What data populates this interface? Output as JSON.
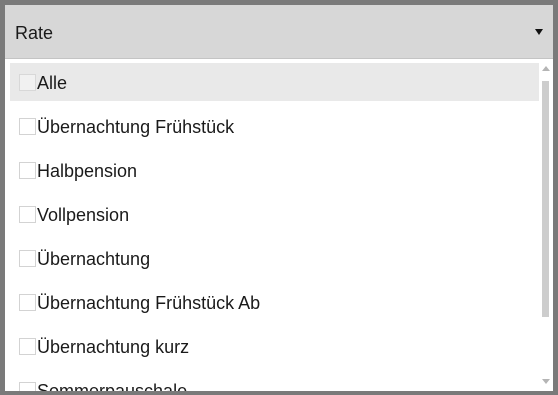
{
  "header": {
    "label": "Rate",
    "icon": "dropdown-arrow-icon"
  },
  "list": {
    "items": [
      {
        "label": "Alle",
        "checked": false,
        "highlighted": true
      },
      {
        "label": "Übernachtung Frühstück",
        "checked": false
      },
      {
        "label": "Halbpension",
        "checked": false
      },
      {
        "label": "Vollpension",
        "checked": false
      },
      {
        "label": "Übernachtung",
        "checked": false
      },
      {
        "label": "Übernachtung Frühstück Ab",
        "checked": false
      },
      {
        "label": "Übernachtung kurz",
        "checked": false
      },
      {
        "label": "Sommerpauschale",
        "checked": false
      }
    ]
  },
  "scrollbar": {
    "up_icon": "scroll-up-arrow-icon",
    "down_icon": "scroll-down-arrow-icon",
    "thumb_fraction": 0.82
  },
  "colors": {
    "header_bg": "#d7d7d7",
    "highlight_bg": "#e9e9e9",
    "frame_border": "#7a7a7a"
  }
}
